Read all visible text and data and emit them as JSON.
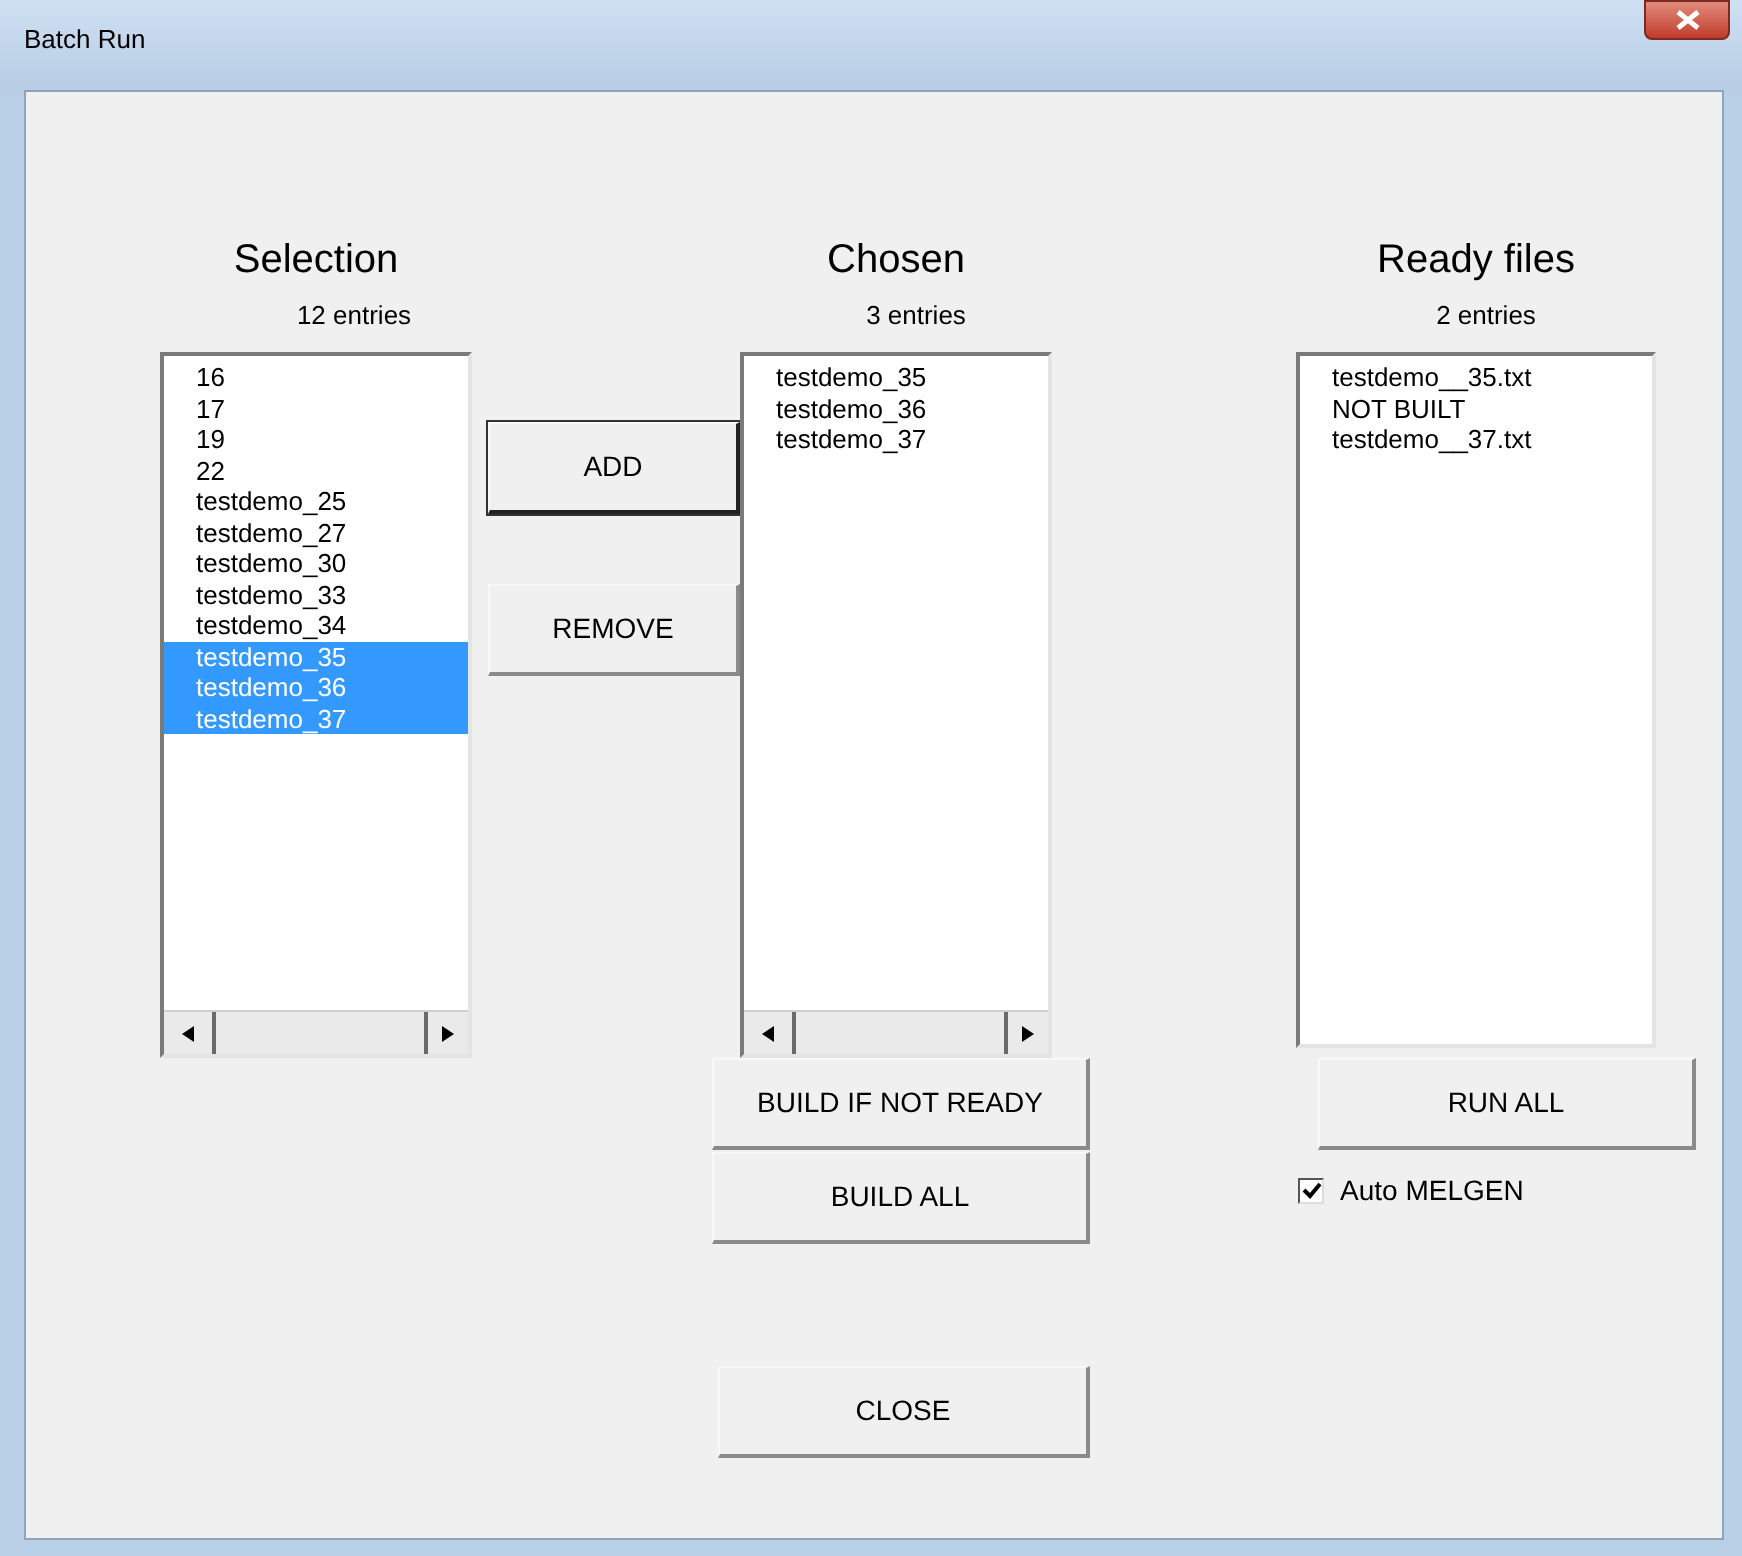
{
  "window": {
    "title": "Batch Run"
  },
  "selection": {
    "heading": "Selection",
    "count": "12 entries",
    "scrollbar": true,
    "items": [
      {
        "label": "16",
        "selected": false
      },
      {
        "label": "17",
        "selected": false
      },
      {
        "label": "19",
        "selected": false
      },
      {
        "label": "22",
        "selected": false
      },
      {
        "label": "testdemo_25",
        "selected": false
      },
      {
        "label": "testdemo_27",
        "selected": false
      },
      {
        "label": "testdemo_30",
        "selected": false
      },
      {
        "label": "testdemo_33",
        "selected": false
      },
      {
        "label": "testdemo_34",
        "selected": false
      },
      {
        "label": "testdemo_35",
        "selected": true
      },
      {
        "label": "testdemo_36",
        "selected": true
      },
      {
        "label": "testdemo_37",
        "selected": true
      }
    ]
  },
  "transfer_buttons": [
    {
      "label": "ADD",
      "focused": true
    },
    {
      "label": "REMOVE",
      "focused": false
    }
  ],
  "chosen": {
    "heading": "Chosen",
    "count": "3 entries",
    "scrollbar": true,
    "items": [
      {
        "label": "testdemo_35",
        "selected": false
      },
      {
        "label": "testdemo_36",
        "selected": false
      },
      {
        "label": "testdemo_37",
        "selected": false
      }
    ]
  },
  "build_buttons": [
    "BUILD IF NOT READY",
    "BUILD ALL"
  ],
  "ready_files": {
    "heading": "Ready files",
    "count": "2 entries",
    "scrollbar": false,
    "items": [
      {
        "label": "testdemo__35.txt",
        "selected": false
      },
      {
        "label": "NOT BUILT",
        "selected": false
      },
      {
        "label": "testdemo__37.txt",
        "selected": false
      }
    ]
  },
  "run_button": "RUN ALL",
  "auto_melgen": {
    "label": "Auto MELGEN",
    "checked": true
  },
  "close_button": "CLOSE"
}
